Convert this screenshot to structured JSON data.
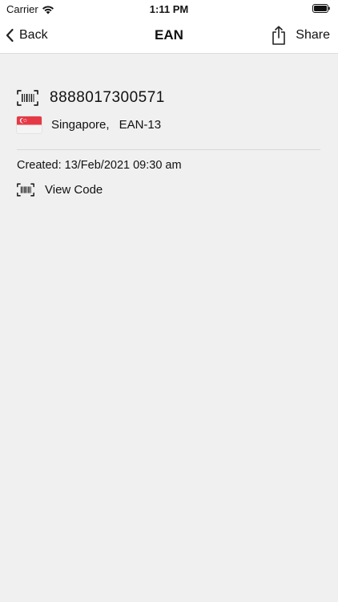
{
  "status_bar": {
    "carrier": "Carrier",
    "time": "1:11 PM"
  },
  "nav": {
    "back_label": "Back",
    "title": "EAN",
    "share_label": "Share"
  },
  "barcode": {
    "value": "8888017300571",
    "country": "Singapore,",
    "type": "EAN-13",
    "created": "Created: 13/Feb/2021 09:30 am",
    "view_code_label": "View Code"
  },
  "icons": {
    "back": "chevron-left-icon",
    "share": "share-icon",
    "barcode": "barcode-icon",
    "flag": "singapore-flag-icon",
    "wifi": "wifi-icon",
    "battery": "battery-icon"
  },
  "colors": {
    "background": "#f0f0f0",
    "bar_background": "#ffffff",
    "flag_red": "#e63946"
  }
}
